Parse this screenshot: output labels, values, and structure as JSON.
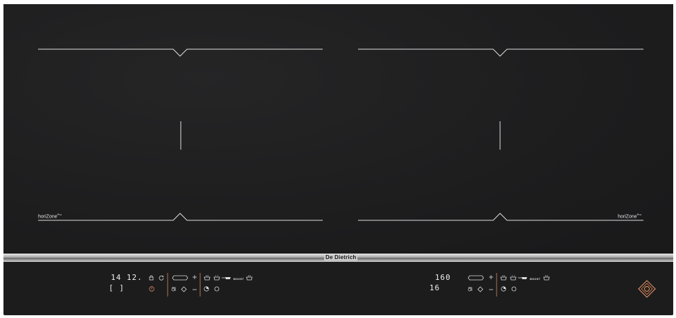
{
  "appliance": {
    "brand": "De Dietrich",
    "zone_left_label": "horiZone",
    "zone_right_label": "horiZone",
    "zone_label_sup": "Pro"
  },
  "left_controls": {
    "display_top": "14 12.",
    "display_bottom": "[ ]",
    "boost_label": "BOOST"
  },
  "right_controls": {
    "display_top": "160",
    "display_bottom": "16",
    "boost_label": "BOOST"
  },
  "colors": {
    "glass": "#1c1c1d",
    "accent_copper": "#d88a62",
    "line": "#e0e0e0"
  }
}
